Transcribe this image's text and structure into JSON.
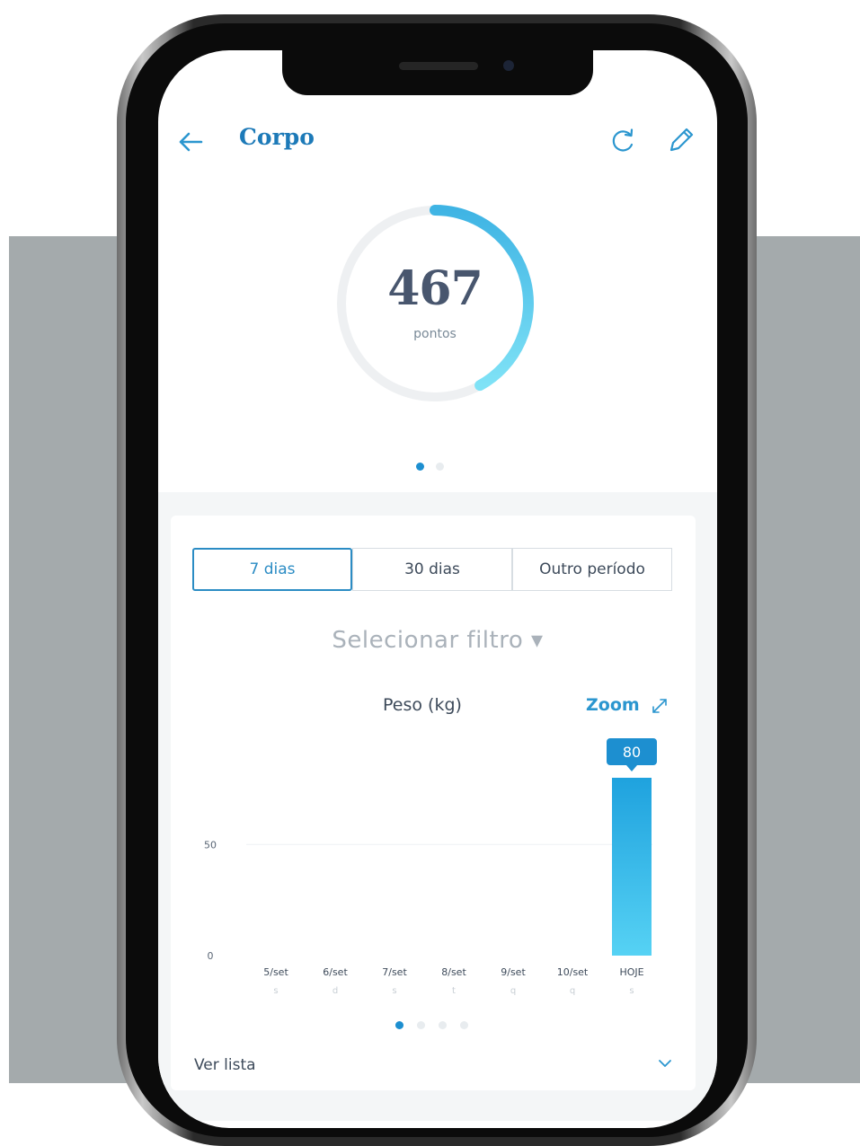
{
  "header": {
    "title": "Corpo"
  },
  "score": {
    "value": "467",
    "label": "pontos",
    "progress": 0.42
  },
  "score_pager": {
    "count": 2,
    "active": 0
  },
  "period_tabs": [
    {
      "label": "7 dias",
      "active": true
    },
    {
      "label": "30 dias",
      "active": false
    },
    {
      "label": "Outro período",
      "active": false
    }
  ],
  "filter": {
    "label": "Selecionar filtro ▾"
  },
  "chart_header": {
    "title": "Peso (kg)",
    "zoom_label": "Zoom"
  },
  "chart_data": {
    "type": "bar",
    "title": "Peso (kg)",
    "categories": [
      "5/set",
      "6/set",
      "7/set",
      "8/set",
      "9/set",
      "10/set",
      "HOJE"
    ],
    "weekdays": [
      "s",
      "d",
      "s",
      "t",
      "q",
      "q",
      "s"
    ],
    "values": [
      0,
      0,
      0,
      0,
      0,
      0,
      80
    ],
    "data_labels": [
      "",
      "",
      "",
      "",
      "",
      "",
      "80"
    ],
    "yticks": [
      0,
      50
    ],
    "ylim": [
      0,
      80
    ],
    "grid": true
  },
  "chart_pager": {
    "count": 4,
    "active": 0
  },
  "footer": {
    "ver_lista": "Ver lista"
  },
  "colors": {
    "accent": "#2b8cc4",
    "bar_top": "#1fa2de",
    "bar_bottom": "#56d2f4",
    "ring_track": "#eef0f2",
    "background_panel": "#a4aaac"
  },
  "icons": [
    "arrow-left-icon",
    "refresh-icon",
    "pencil-icon",
    "expand-icon",
    "chevron-down-icon"
  ]
}
